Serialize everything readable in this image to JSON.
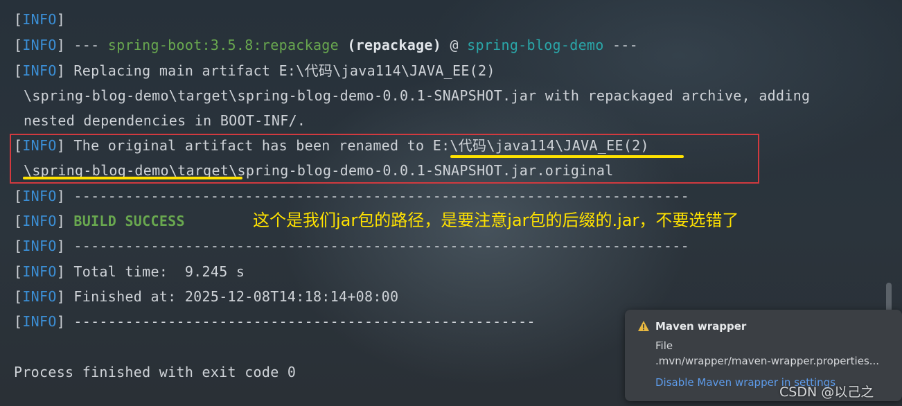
{
  "console": {
    "info_tag": "INFO",
    "line_repackage": {
      "prefix": "---",
      "plugin": "spring-boot:3.5.8:repackage",
      "goal": "(repackage)",
      "at": "@",
      "project": "spring-blog-demo",
      "suffix": "---"
    },
    "replacing": {
      "l1": "Replacing main artifact E:\\代码\\java114\\JAVA_EE(2)",
      "l2": "\\spring-blog-demo\\target\\spring-blog-demo-0.0.1-SNAPSHOT.jar with repackaged archive, adding",
      "l3": "nested dependencies in BOOT-INF/."
    },
    "renamed": {
      "l1_prefix": "The original artifact has been renamed to ",
      "l1_path": "E:\\代码\\java114\\JAVA_EE(2)",
      "l2_path": "\\spring-blog-demo\\target",
      "l2_rest": "\\spring-blog-demo-0.0.1-SNAPSHOT.jar.original"
    },
    "separator": "------------------------------------------------------------------------",
    "build_success": "BUILD SUCCESS",
    "total_time": "Total time:  9.245 s",
    "finished_at": "Finished at: 2025-12-08T14:18:14+08:00",
    "separator_partial": "------------------------------------------------------",
    "exit": "Process finished with exit code 0"
  },
  "annotation": {
    "text": "这个是我们jar包的路径，是要注意jar包的后缀的.jar，不要选错了",
    "color": "#ffe200"
  },
  "notification": {
    "title": "Maven wrapper",
    "line1": "File",
    "line2": ".mvn/wrapper/maven-wrapper.properties...",
    "link": "Disable Maven wrapper in settings",
    "icon": "warning-icon"
  },
  "watermark": "CSDN @以己之",
  "colors": {
    "info": "#3b8fd6",
    "plugin": "#69a84f",
    "project": "#2aa7a9",
    "highlight_box": "#d23a3f",
    "underline": "#ffe200"
  }
}
